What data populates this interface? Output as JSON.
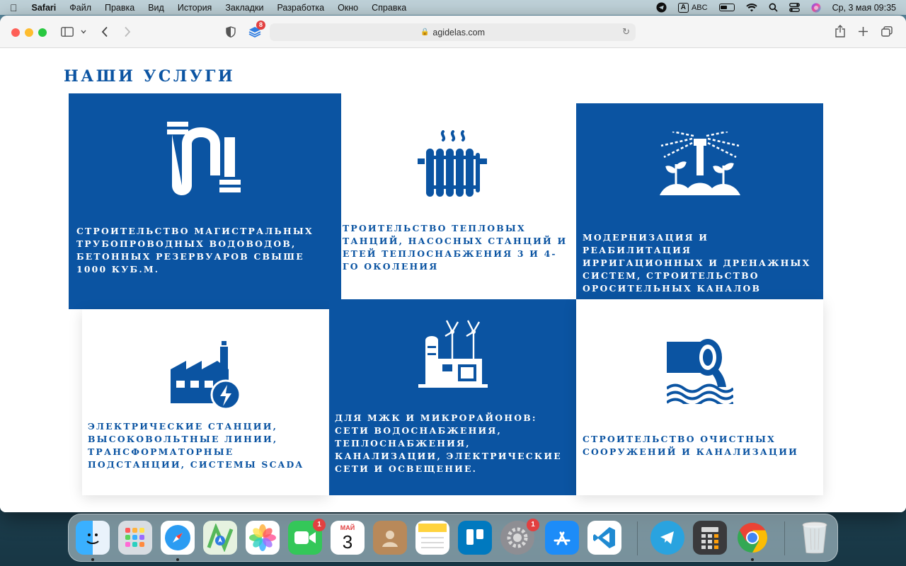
{
  "menubar": {
    "app_name": "Safari",
    "items": [
      "Файл",
      "Правка",
      "Вид",
      "История",
      "Закладки",
      "Разработка",
      "Окно",
      "Справка"
    ],
    "keyboard_layout": "A",
    "input_source": "ABC",
    "datetime": "Ср, 3 мая  09:35"
  },
  "browser": {
    "url": "agidelas.com",
    "extension_badge": "8"
  },
  "page": {
    "title": "НАШИ УСЛУГИ",
    "services": [
      {
        "text": "СТРОИТЕЛЬСТВО МАГИСТРАЛЬНЫХ ТРУБОПРОВОДНЫХ ВОДОВОДОВ, БЕТОННЫХ РЕЗЕРВУАРОВ СВЫШЕ 1000 КУБ.М.",
        "icon": "pipe-icon"
      },
      {
        "text": "ТРОИТЕЛЬСТВО ТЕПЛОВЫХ ТАНЦИЙ, НАСОСНЫХ СТАНЦИЙ И ЕТЕЙ ТЕПЛОСНАБЖЕНИЯ 3 И 4-ГО ОКОЛЕНИЯ",
        "icon": "radiator-icon"
      },
      {
        "text": "МОДЕРНИЗАЦИЯ И РЕАБИЛИТАЦИЯ ИРРИГАЦИОННЫХ И ДРЕНАЖНЫХ СИСТЕМ, СТРОИТЕЛЬСТВО ОРОСИТЕЛЬНЫХ КАНАЛОВ",
        "icon": "sprinkler-icon"
      },
      {
        "text": "ЭЛЕКТРИЧЕСКИЕ СТАНЦИИ, ВЫСОКОВОЛЬТНЫЕ ЛИНИИ, ТРАНСФОРМАТОРНЫЕ ПОДСТАНЦИИ, СИСТЕМЫ SCADA",
        "icon": "power-plant-icon"
      },
      {
        "text": "ДЛЯ МЖК И МИКРОРАЙОНОВ: СЕТИ ВОДОСНАБЖЕНИЯ, ТЕПЛОСНАБЖЕНИЯ, КАНАЛИЗАЦИИ, ЭЛЕКТРИЧЕСКИЕ СЕТИ И ОСВЕЩЕНИЕ.",
        "icon": "city-utilities-icon"
      },
      {
        "text": "СТРОИТЕЛЬСТВО ОЧИСТНЫХ СООРУЖЕНИЙ И КАНАЛИЗАЦИИ",
        "icon": "sewage-pipe-icon"
      }
    ]
  },
  "dock": {
    "calendar_month": "МАЙ",
    "calendar_day": "3",
    "facetime_badge": "1",
    "settings_badge": "1"
  },
  "colors": {
    "brand_blue": "#0b54a2",
    "white": "#ffffff"
  }
}
